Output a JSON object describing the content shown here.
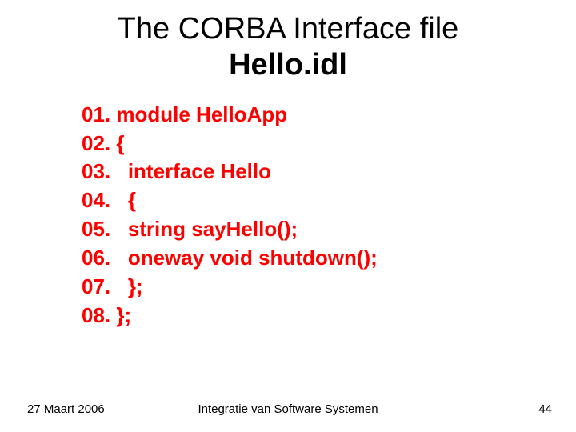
{
  "title": {
    "line1": "The CORBA Interface file",
    "line2": "Hello.idl"
  },
  "code": {
    "lines": [
      "01. module HelloApp",
      "02. {",
      "03.   interface Hello",
      "04.   {",
      "05.   string sayHello();",
      "06.   oneway void shutdown();",
      "07.   };",
      "08. };"
    ]
  },
  "footer": {
    "date": "27 Maart 2006",
    "center": "Integratie van Software Systemen",
    "page": "44"
  }
}
